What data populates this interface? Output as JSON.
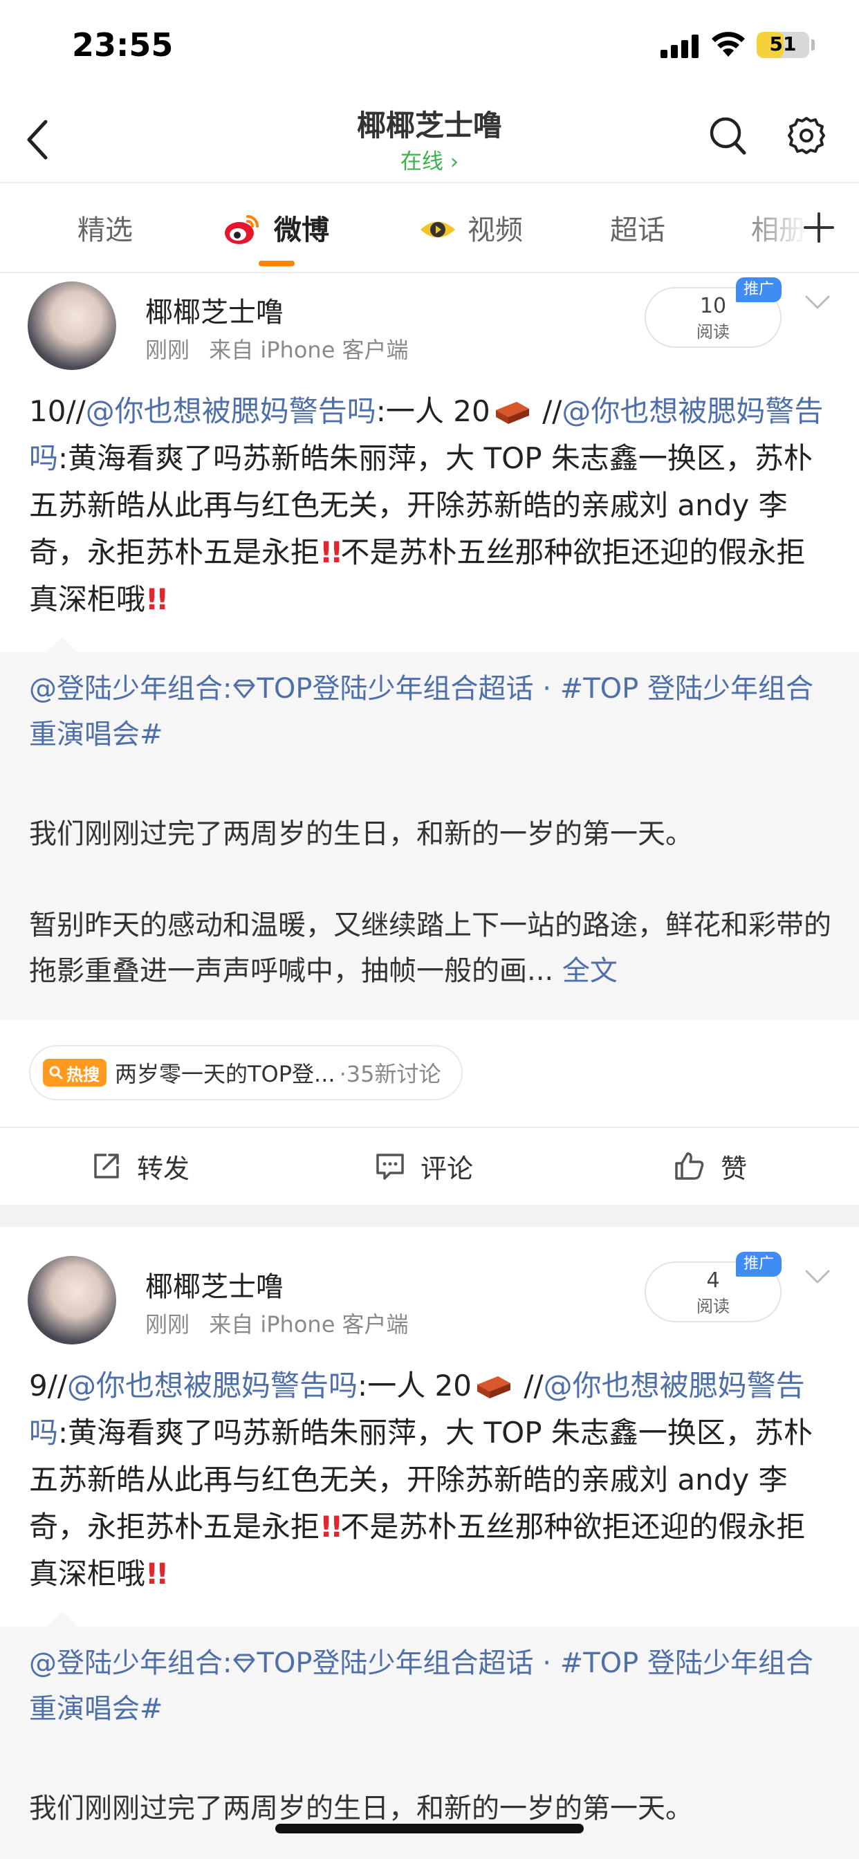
{
  "status_bar": {
    "time": "23:55",
    "battery": "51",
    "battery_level": 0.51
  },
  "header": {
    "title": "椰椰芝士噜",
    "online_status": "在线 ›"
  },
  "tabs": [
    {
      "label": "精选"
    },
    {
      "label": "微博",
      "active": true
    },
    {
      "label": "视频"
    },
    {
      "label": "超话"
    },
    {
      "label": "相册"
    }
  ],
  "posts": [
    {
      "author": "椰椰芝士噜",
      "time": "刚刚",
      "source": "来自 iPhone 客户端",
      "reads": "10",
      "reads_label": "阅读",
      "promo_badge": "推广",
      "text": {
        "seg1": "10//",
        "mention1": "@你也想被腮妈警告吗",
        "seg2": ":一人 20",
        "seg3": " //",
        "mention2": "@你也想被腮妈警告吗",
        "seg4": ":黄海看爽了吗苏新皓朱丽萍，大 TOP 朱志鑫一换区，苏朴五苏新皓从此再与红色无关，开除苏新皓的亲戚刘 andy 李奇，永拒苏朴五是永拒",
        "exclaim1": "!!",
        "seg5": "不是苏朴五丝那种欲拒还迎的假永拒真深柜哦",
        "exclaim2": "!!"
      },
      "quote": {
        "author": "@登陆少年组合:",
        "topic1": "TOP登陆少年组合超话",
        "separator": " · ",
        "topic2": "#TOP 登陆少年组合重演唱会#",
        "para1": "我们刚刚过完了两周岁的生日，和新的一岁的第一天。",
        "para2": "暂别昨天的感动和温暖，又继续踏上下一站的路途，鲜花和彩带的拖影重叠进一声声呼喊中，抽帧一般的画...",
        "full_text_link": " 全文"
      },
      "hot": {
        "badge": "热搜",
        "title": "两岁零一天的TOP登...",
        "count": "·35新讨论"
      },
      "actions": {
        "repost": "转发",
        "comment": "评论",
        "like": "赞"
      }
    },
    {
      "author": "椰椰芝士噜",
      "time": "刚刚",
      "source": "来自 iPhone 客户端",
      "reads": "4",
      "reads_label": "阅读",
      "promo_badge": "推广",
      "text": {
        "seg1": "9//",
        "mention1": "@你也想被腮妈警告吗",
        "seg2": ":一人 20",
        "seg3": " //",
        "mention2": "@你也想被腮妈警告吗",
        "seg4": ":黄海看爽了吗苏新皓朱丽萍，大 TOP 朱志鑫一换区，苏朴五苏新皓从此再与红色无关，开除苏新皓的亲戚刘 andy 李奇，永拒苏朴五是永拒",
        "exclaim1": "!!",
        "seg5": "不是苏朴五丝那种欲拒还迎的假永拒真深柜哦",
        "exclaim2": "!!"
      },
      "quote": {
        "author": "@登陆少年组合:",
        "topic1": "TOP登陆少年组合超话",
        "separator": " · ",
        "topic2": "#TOP 登陆少年组合重演唱会#",
        "para1": "我们刚刚过完了两周岁的生日，和新的一岁的第一天。"
      }
    }
  ],
  "icons": {
    "back": "chevron-left-icon",
    "search": "search-icon",
    "settings": "gear-icon",
    "add": "plus-icon",
    "weibo_tab": "weibo-logo-icon",
    "video_tab": "video-eye-icon",
    "brick": "brick-icon",
    "repost": "repost-icon",
    "comment": "comment-icon",
    "like": "thumbs-up-icon"
  },
  "colors": {
    "accent": "#ff8200",
    "link": "#4f6fa8",
    "online": "#3bb34a",
    "promo": "#3f8cf2",
    "hot": "#ff9a1f",
    "exclaim": "#e0272f"
  }
}
